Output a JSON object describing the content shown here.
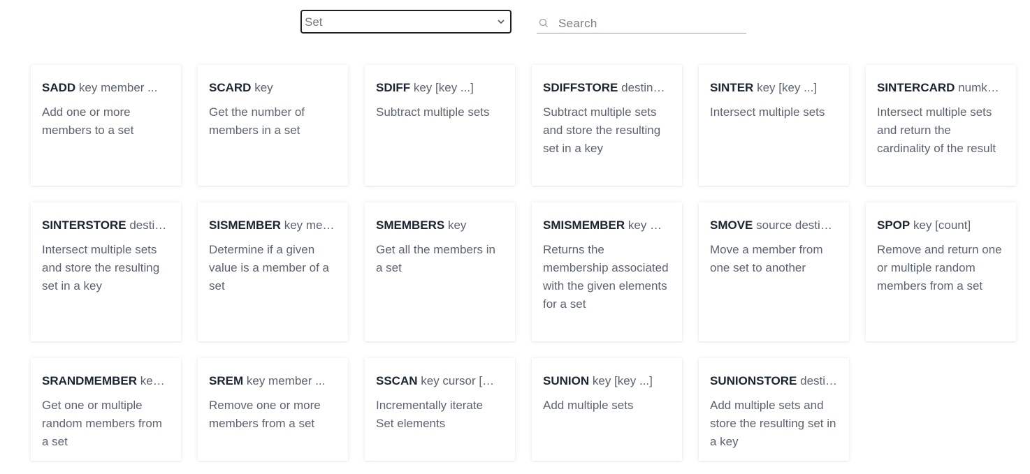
{
  "filter": {
    "group_value": "Set",
    "search_placeholder": "Search"
  },
  "commands": [
    {
      "name": "SADD",
      "args": "key member ...",
      "desc": "Add one or more members to a set"
    },
    {
      "name": "SCARD",
      "args": "key",
      "desc": "Get the number of members in a set"
    },
    {
      "name": "SDIFF",
      "args": "key [key ...]",
      "desc": "Subtract multiple sets"
    },
    {
      "name": "SDIFFSTORE",
      "args": "destination key [key ...]",
      "desc": "Subtract multiple sets and store the resulting set in a key"
    },
    {
      "name": "SINTER",
      "args": "key [key ...]",
      "desc": "Intersect multiple sets"
    },
    {
      "name": "SINTERCARD",
      "args": "numkeys key [key ...]",
      "desc": "Intersect multiple sets and return the cardinality of the result"
    },
    {
      "name": "SINTERSTORE",
      "args": "destination key [key ...]",
      "desc": "Intersect multiple sets and store the resulting set in a key"
    },
    {
      "name": "SISMEMBER",
      "args": "key member",
      "desc": "Determine if a given value is a member of a set"
    },
    {
      "name": "SMEMBERS",
      "args": "key",
      "desc": "Get all the members in a set"
    },
    {
      "name": "SMISMEMBER",
      "args": "key member ...",
      "desc": "Returns the membership associated with the given elements for a set"
    },
    {
      "name": "SMOVE",
      "args": "source destination member",
      "desc": "Move a member from one set to another"
    },
    {
      "name": "SPOP",
      "args": "key [count]",
      "desc": "Remove and return one or multiple random members from a set"
    },
    {
      "name": "SRANDMEMBER",
      "args": "key [count]",
      "desc": "Get one or multiple random members from a set"
    },
    {
      "name": "SREM",
      "args": "key member ...",
      "desc": "Remove one or more members from a set"
    },
    {
      "name": "SSCAN",
      "args": "key cursor [MATCH pattern]",
      "desc": "Incrementally iterate Set elements"
    },
    {
      "name": "SUNION",
      "args": "key [key ...]",
      "desc": "Add multiple sets"
    },
    {
      "name": "SUNIONSTORE",
      "args": "destination key [key ...]",
      "desc": "Add multiple sets and store the resulting set in a key"
    }
  ]
}
